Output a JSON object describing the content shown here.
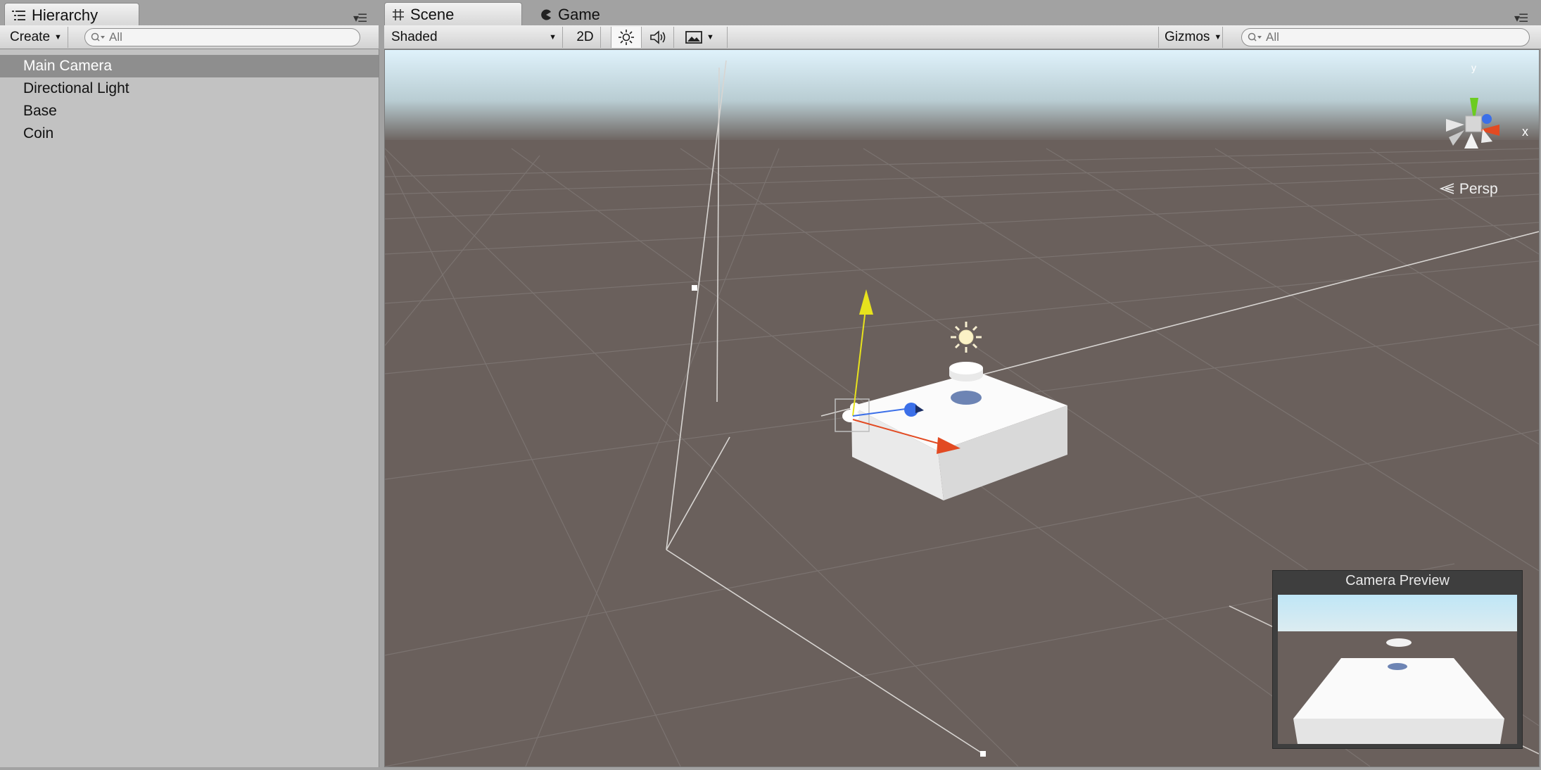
{
  "hierarchy": {
    "tab_label": "Hierarchy",
    "create_label": "Create",
    "search_placeholder": "All",
    "items": [
      {
        "label": "Main Camera",
        "selected": true
      },
      {
        "label": "Directional Light",
        "selected": false
      },
      {
        "label": "Base",
        "selected": false
      },
      {
        "label": "Coin",
        "selected": false
      }
    ]
  },
  "scene": {
    "tabs": [
      {
        "label": "Scene",
        "icon": "grid-icon",
        "active": true
      },
      {
        "label": "Game",
        "icon": "pacman-icon",
        "active": false
      }
    ],
    "toolbar": {
      "shading_mode": "Shaded",
      "mode_2d_label": "2D",
      "gizmos_label": "Gizmos",
      "search_placeholder": "All",
      "icons": [
        "sun-icon",
        "speaker-icon",
        "image-icon"
      ]
    },
    "projection_label": "Persp",
    "axis_label": "x",
    "axis_label_y": "y"
  },
  "camera_preview": {
    "title": "Camera Preview"
  },
  "colors": {
    "selection": "#8e8e8e",
    "ground": "#695f5b",
    "sky": "#d6eef8",
    "x_axis": "#e24a22",
    "y_axis": "#e7e21d",
    "z_axis": "#3b6fe8",
    "gizmo_green": "#6ccc21"
  }
}
